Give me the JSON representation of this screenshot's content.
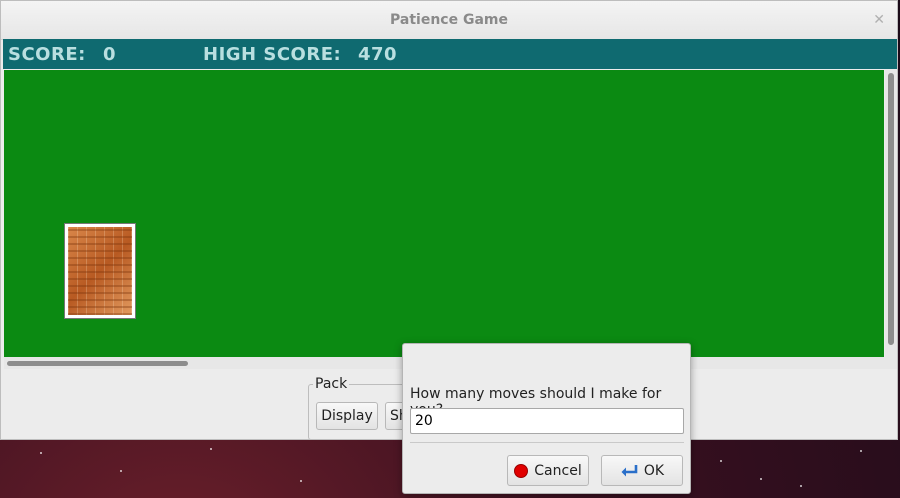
{
  "window": {
    "title": "Patience Game"
  },
  "scorebar": {
    "score_label": "SCORE:",
    "score_value": "0",
    "high_label": "HIGH SCORE:",
    "high_value": "470"
  },
  "pack": {
    "legend": "Pack",
    "display_label": "Display",
    "second_label_partial": "Sh"
  },
  "dialog": {
    "prompt": "How many moves should I make for you?",
    "input_value": "20",
    "cancel_label": "Cancel",
    "ok_label": "OK"
  },
  "colors": {
    "felt": "#0b8a12",
    "scorebar": "#0f6a70"
  }
}
